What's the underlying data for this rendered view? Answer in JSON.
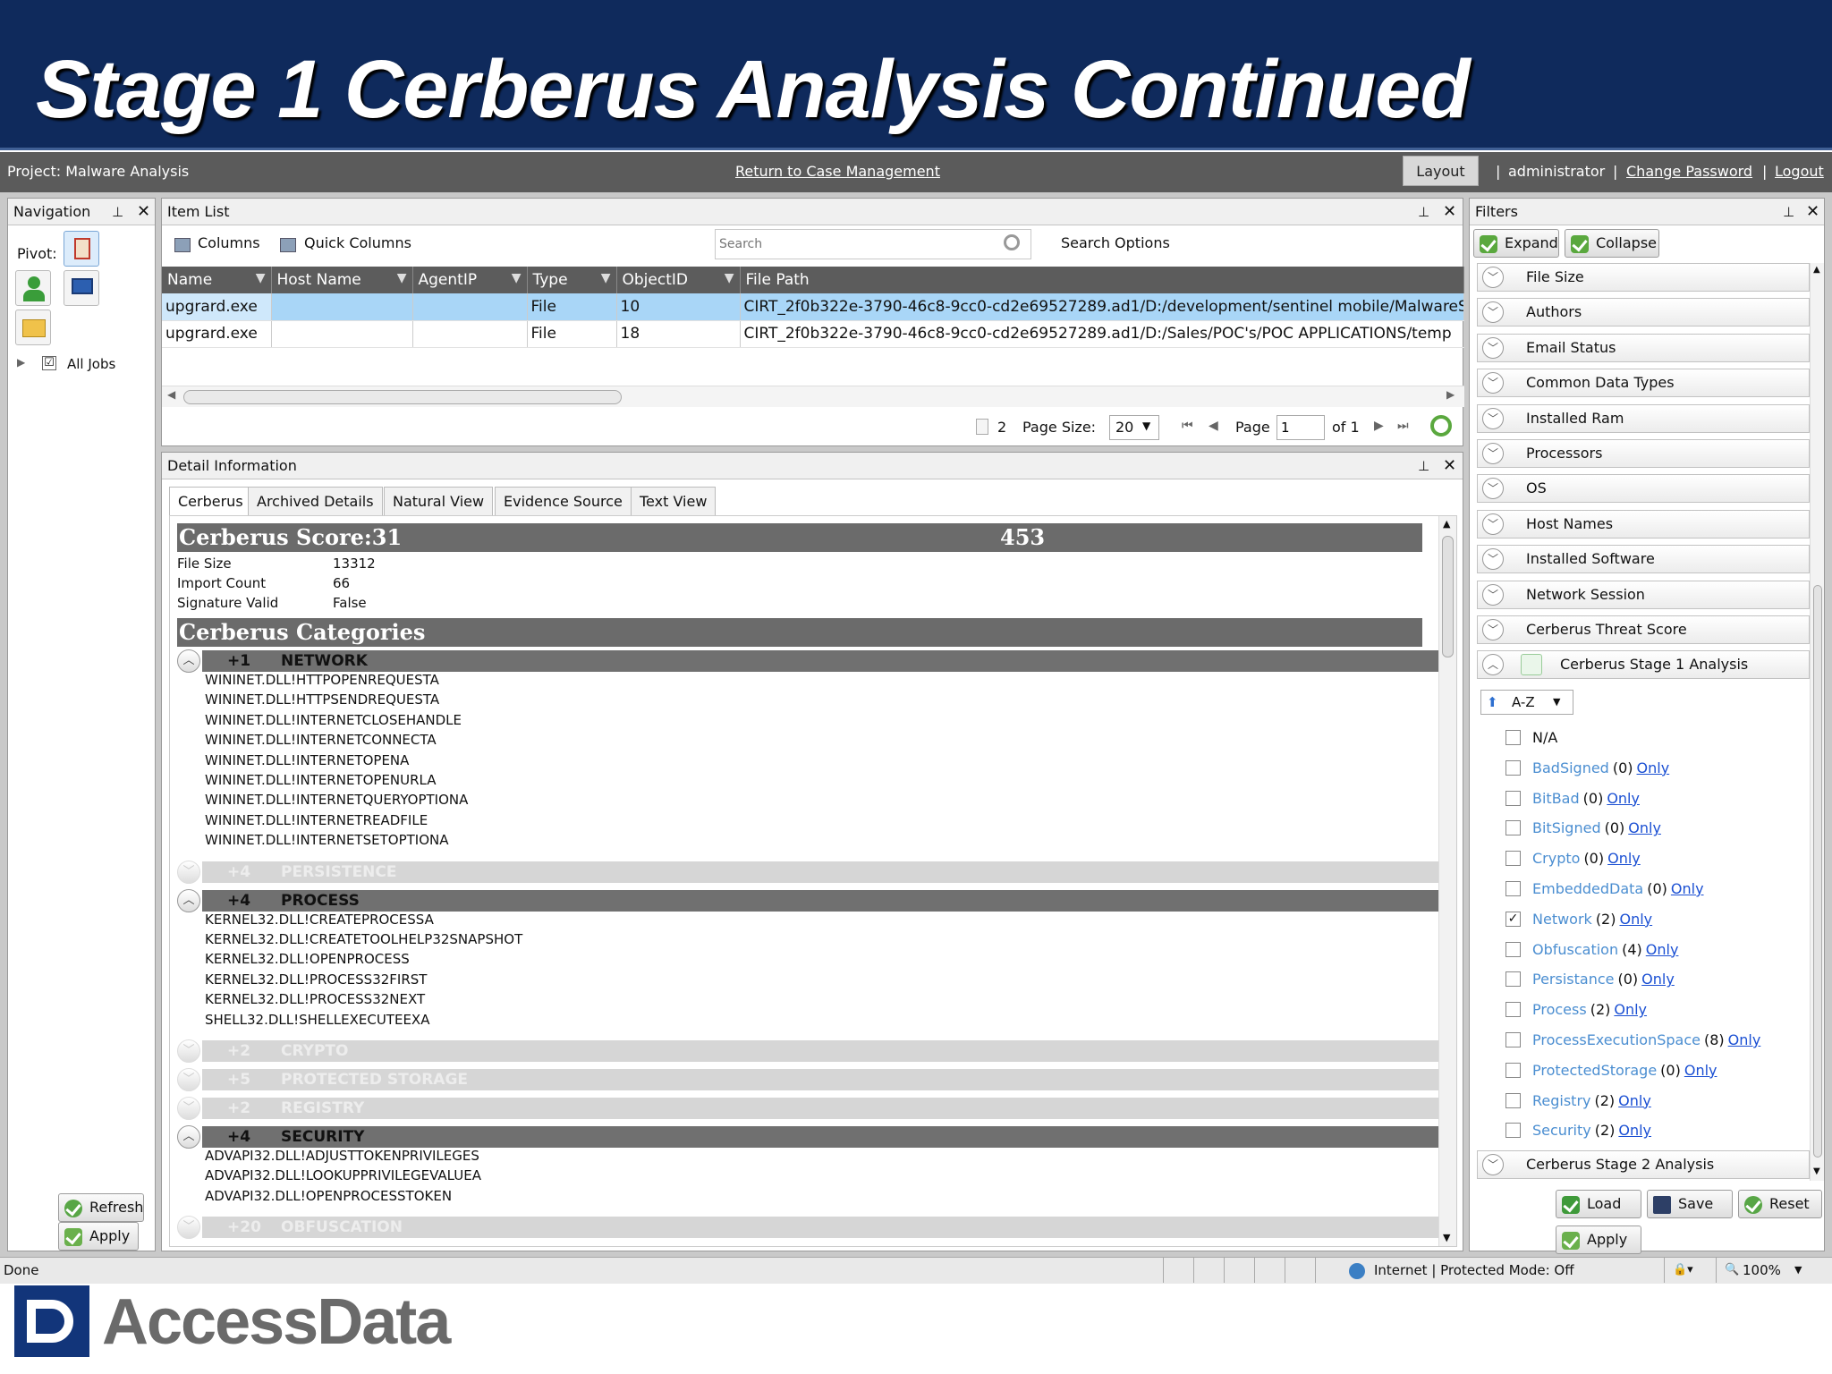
{
  "slide": {
    "title": "Stage 1 Cerberus Analysis Continued"
  },
  "topbar": {
    "project": "Project: Malware Analysis",
    "return_link": "Return to Case Management",
    "layout": "Layout",
    "user": "administrator",
    "change_password": "Change Password",
    "logout": "Logout"
  },
  "navigation": {
    "title": "Navigation",
    "pivot": "Pivot:",
    "all_jobs": "All Jobs",
    "refresh": "Refresh",
    "apply": "Apply"
  },
  "item_list": {
    "title": "Item List",
    "columns": "Columns",
    "quick_columns": "Quick Columns",
    "search_placeholder": "Search",
    "search_options": "Search Options",
    "headers": [
      "Name",
      "Host Name",
      "AgentIP",
      "Type",
      "ObjectID",
      "File Path"
    ],
    "rows": [
      [
        "upgrard.exe",
        "",
        "",
        "File",
        "10",
        "CIRT_2f0b322e-3790-46c8-9cc0-cd2e69527289.ad1/D:/development/sentinel mobile/MalwareS"
      ],
      [
        "upgrard.exe",
        "",
        "",
        "File",
        "18",
        "CIRT_2f0b322e-3790-46c8-9cc0-cd2e69527289.ad1/D:/Sales/POC's/POC APPLICATIONS/temp"
      ]
    ],
    "count": "2",
    "page_size_label": "Page Size:",
    "page_size": "20",
    "page_label": "Page",
    "page": "1",
    "of": "of 1"
  },
  "detail": {
    "title": "Detail Information",
    "tabs": [
      "Cerberus",
      "Archived Details",
      "Natural View",
      "Evidence Source",
      "Text View"
    ],
    "score_title": "Cerberus Score:31",
    "score_value": "453",
    "props": [
      [
        "File Size",
        "13312"
      ],
      [
        "Import Count",
        "66"
      ],
      [
        "Signature Valid",
        "False"
      ]
    ],
    "categories_title": "Cerberus Categories",
    "categories": [
      {
        "score": "+1",
        "name": "NETWORK",
        "enabled": true,
        "apis": [
          "WININET.DLL!HTTPOPENREQUESTA",
          "WININET.DLL!HTTPSENDREQUESTA",
          "WININET.DLL!INTERNETCLOSEHANDLE",
          "WININET.DLL!INTERNETCONNECTA",
          "WININET.DLL!INTERNETOPENA",
          "WININET.DLL!INTERNETOPENURLA",
          "WININET.DLL!INTERNETQUERYOPTIONA",
          "WININET.DLL!INTERNETREADFILE",
          "WININET.DLL!INTERNETSETOPTIONA"
        ]
      },
      {
        "score": "+4",
        "name": "PERSISTENCE",
        "enabled": false,
        "apis": []
      },
      {
        "score": "+4",
        "name": "PROCESS",
        "enabled": true,
        "apis": [
          "KERNEL32.DLL!CREATEPROCESSA",
          "KERNEL32.DLL!CREATETOOLHELP32SNAPSHOT",
          "KERNEL32.DLL!OPENPROCESS",
          "KERNEL32.DLL!PROCESS32FIRST",
          "KERNEL32.DLL!PROCESS32NEXT",
          "SHELL32.DLL!SHELLEXECUTEEXA"
        ]
      },
      {
        "score": "+2",
        "name": "CRYPTO",
        "enabled": false,
        "apis": []
      },
      {
        "score": "+5",
        "name": "PROTECTED STORAGE",
        "enabled": false,
        "apis": []
      },
      {
        "score": "+2",
        "name": "REGISTRY",
        "enabled": false,
        "apis": []
      },
      {
        "score": "+4",
        "name": "SECURITY",
        "enabled": true,
        "apis": [
          "ADVAPI32.DLL!ADJUSTTOKENPRIVILEGES",
          "ADVAPI32.DLL!LOOKUPPRIVILEGEVALUEA",
          "ADVAPI32.DLL!OPENPROCESSTOKEN"
        ]
      },
      {
        "score": "+20",
        "name": "OBFUSCATION",
        "enabled": false,
        "apis": []
      }
    ]
  },
  "filters": {
    "title": "Filters",
    "expand": "Expand",
    "collapse": "Collapse",
    "facets": [
      "File Size",
      "Authors",
      "Email Status",
      "Common Data Types",
      "Installed Ram",
      "Processors",
      "OS",
      "Host Names",
      "Installed Software",
      "Network Session",
      "Cerberus Threat Score"
    ],
    "stage1": "Cerberus Stage 1 Analysis",
    "sort": "A-Z",
    "na": "N/A",
    "items": [
      {
        "name": "BadSigned",
        "count": "(0)",
        "checked": false
      },
      {
        "name": "BitBad",
        "count": "(0)",
        "checked": false
      },
      {
        "name": "BitSigned",
        "count": "(0)",
        "checked": false
      },
      {
        "name": "Crypto",
        "count": "(0)",
        "checked": false
      },
      {
        "name": "EmbeddedData",
        "count": "(0)",
        "checked": false
      },
      {
        "name": "Network",
        "count": "(2)",
        "checked": true
      },
      {
        "name": "Obfuscation",
        "count": "(4)",
        "checked": false
      },
      {
        "name": "Persistance",
        "count": "(0)",
        "checked": false
      },
      {
        "name": "Process",
        "count": "(2)",
        "checked": false
      },
      {
        "name": "ProcessExecutionSpace",
        "count": "(8)",
        "checked": false
      },
      {
        "name": "ProtectedStorage",
        "count": "(0)",
        "checked": false
      },
      {
        "name": "Registry",
        "count": "(2)",
        "checked": false
      },
      {
        "name": "Security",
        "count": "(2)",
        "checked": false
      }
    ],
    "only": "Only",
    "stage2": "Cerberus Stage 2 Analysis",
    "load": "Load",
    "save": "Save",
    "reset": "Reset",
    "apply": "Apply"
  },
  "statusbar": {
    "left": "Done",
    "zone": "Internet | Protected Mode: Off",
    "zoom": "100%"
  },
  "logo": {
    "text": "AccessData"
  },
  "colors": {
    "header_bg": "#0f2a5c",
    "selected_row": "#a9d6f7",
    "filter_link": "#4b8ed1",
    "only_link": "#1a4fd3"
  }
}
